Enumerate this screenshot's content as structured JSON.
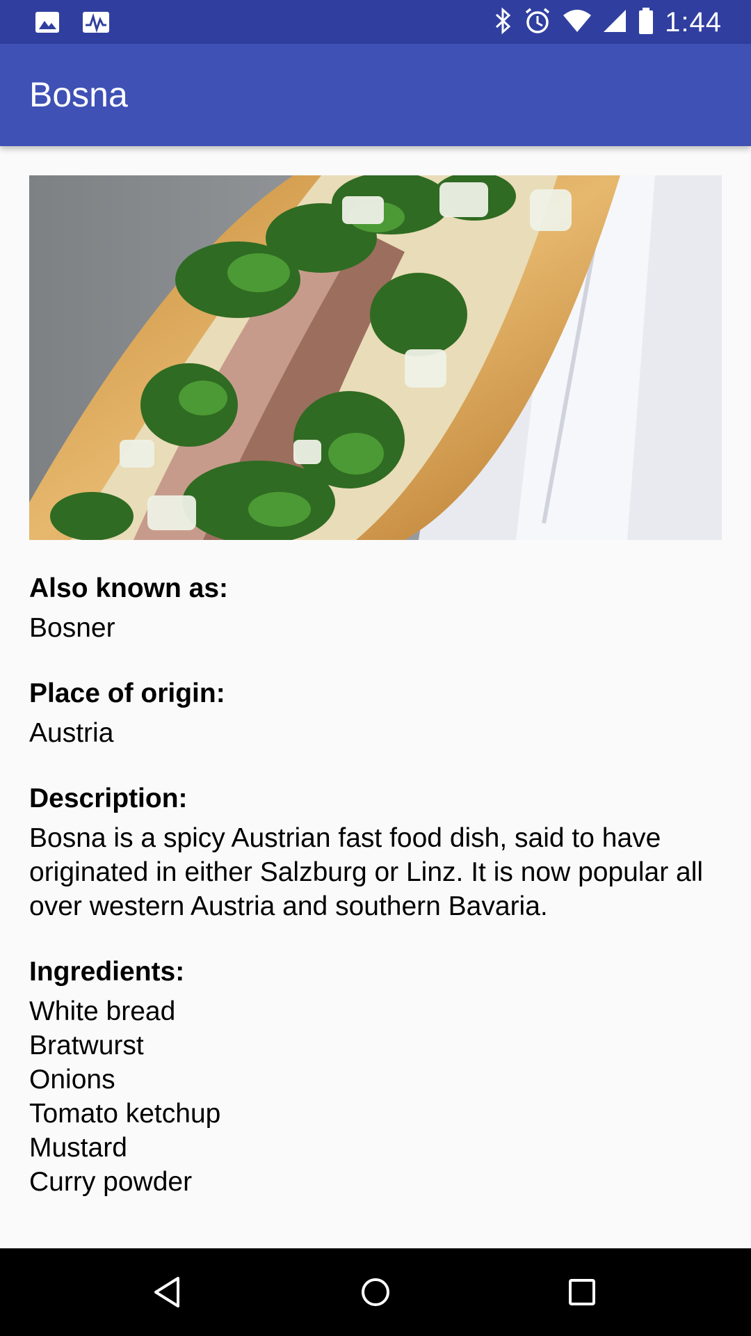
{
  "status_bar": {
    "time": "1:44",
    "icons": [
      "image-icon",
      "activity-icon",
      "bluetooth-icon",
      "alarm-icon",
      "wifi-icon",
      "signal-icon",
      "battery-icon"
    ]
  },
  "app_bar": {
    "title": "Bosna"
  },
  "details": {
    "also_known_as_label": "Also known as:",
    "also_known_as_value": "Bosner",
    "origin_label": "Place of origin:",
    "origin_value": "Austria",
    "description_label": "Description:",
    "description_value": "Bosna is a spicy Austrian fast food dish, said to have originated in either Salzburg or Linz. It is now popular all over western Austria and southern Bavaria.",
    "ingredients_label": "Ingredients:",
    "ingredients": [
      "White bread",
      "Bratwurst",
      "Onions",
      "Tomato ketchup",
      "Mustard",
      "Curry powder"
    ]
  },
  "nav_bar": {
    "icons": [
      "back-icon",
      "home-icon",
      "recents-icon"
    ]
  },
  "colors": {
    "status_bar": "#303f9f",
    "app_bar": "#3f51b5",
    "background": "#fafafa",
    "nav_bar": "#000000"
  }
}
